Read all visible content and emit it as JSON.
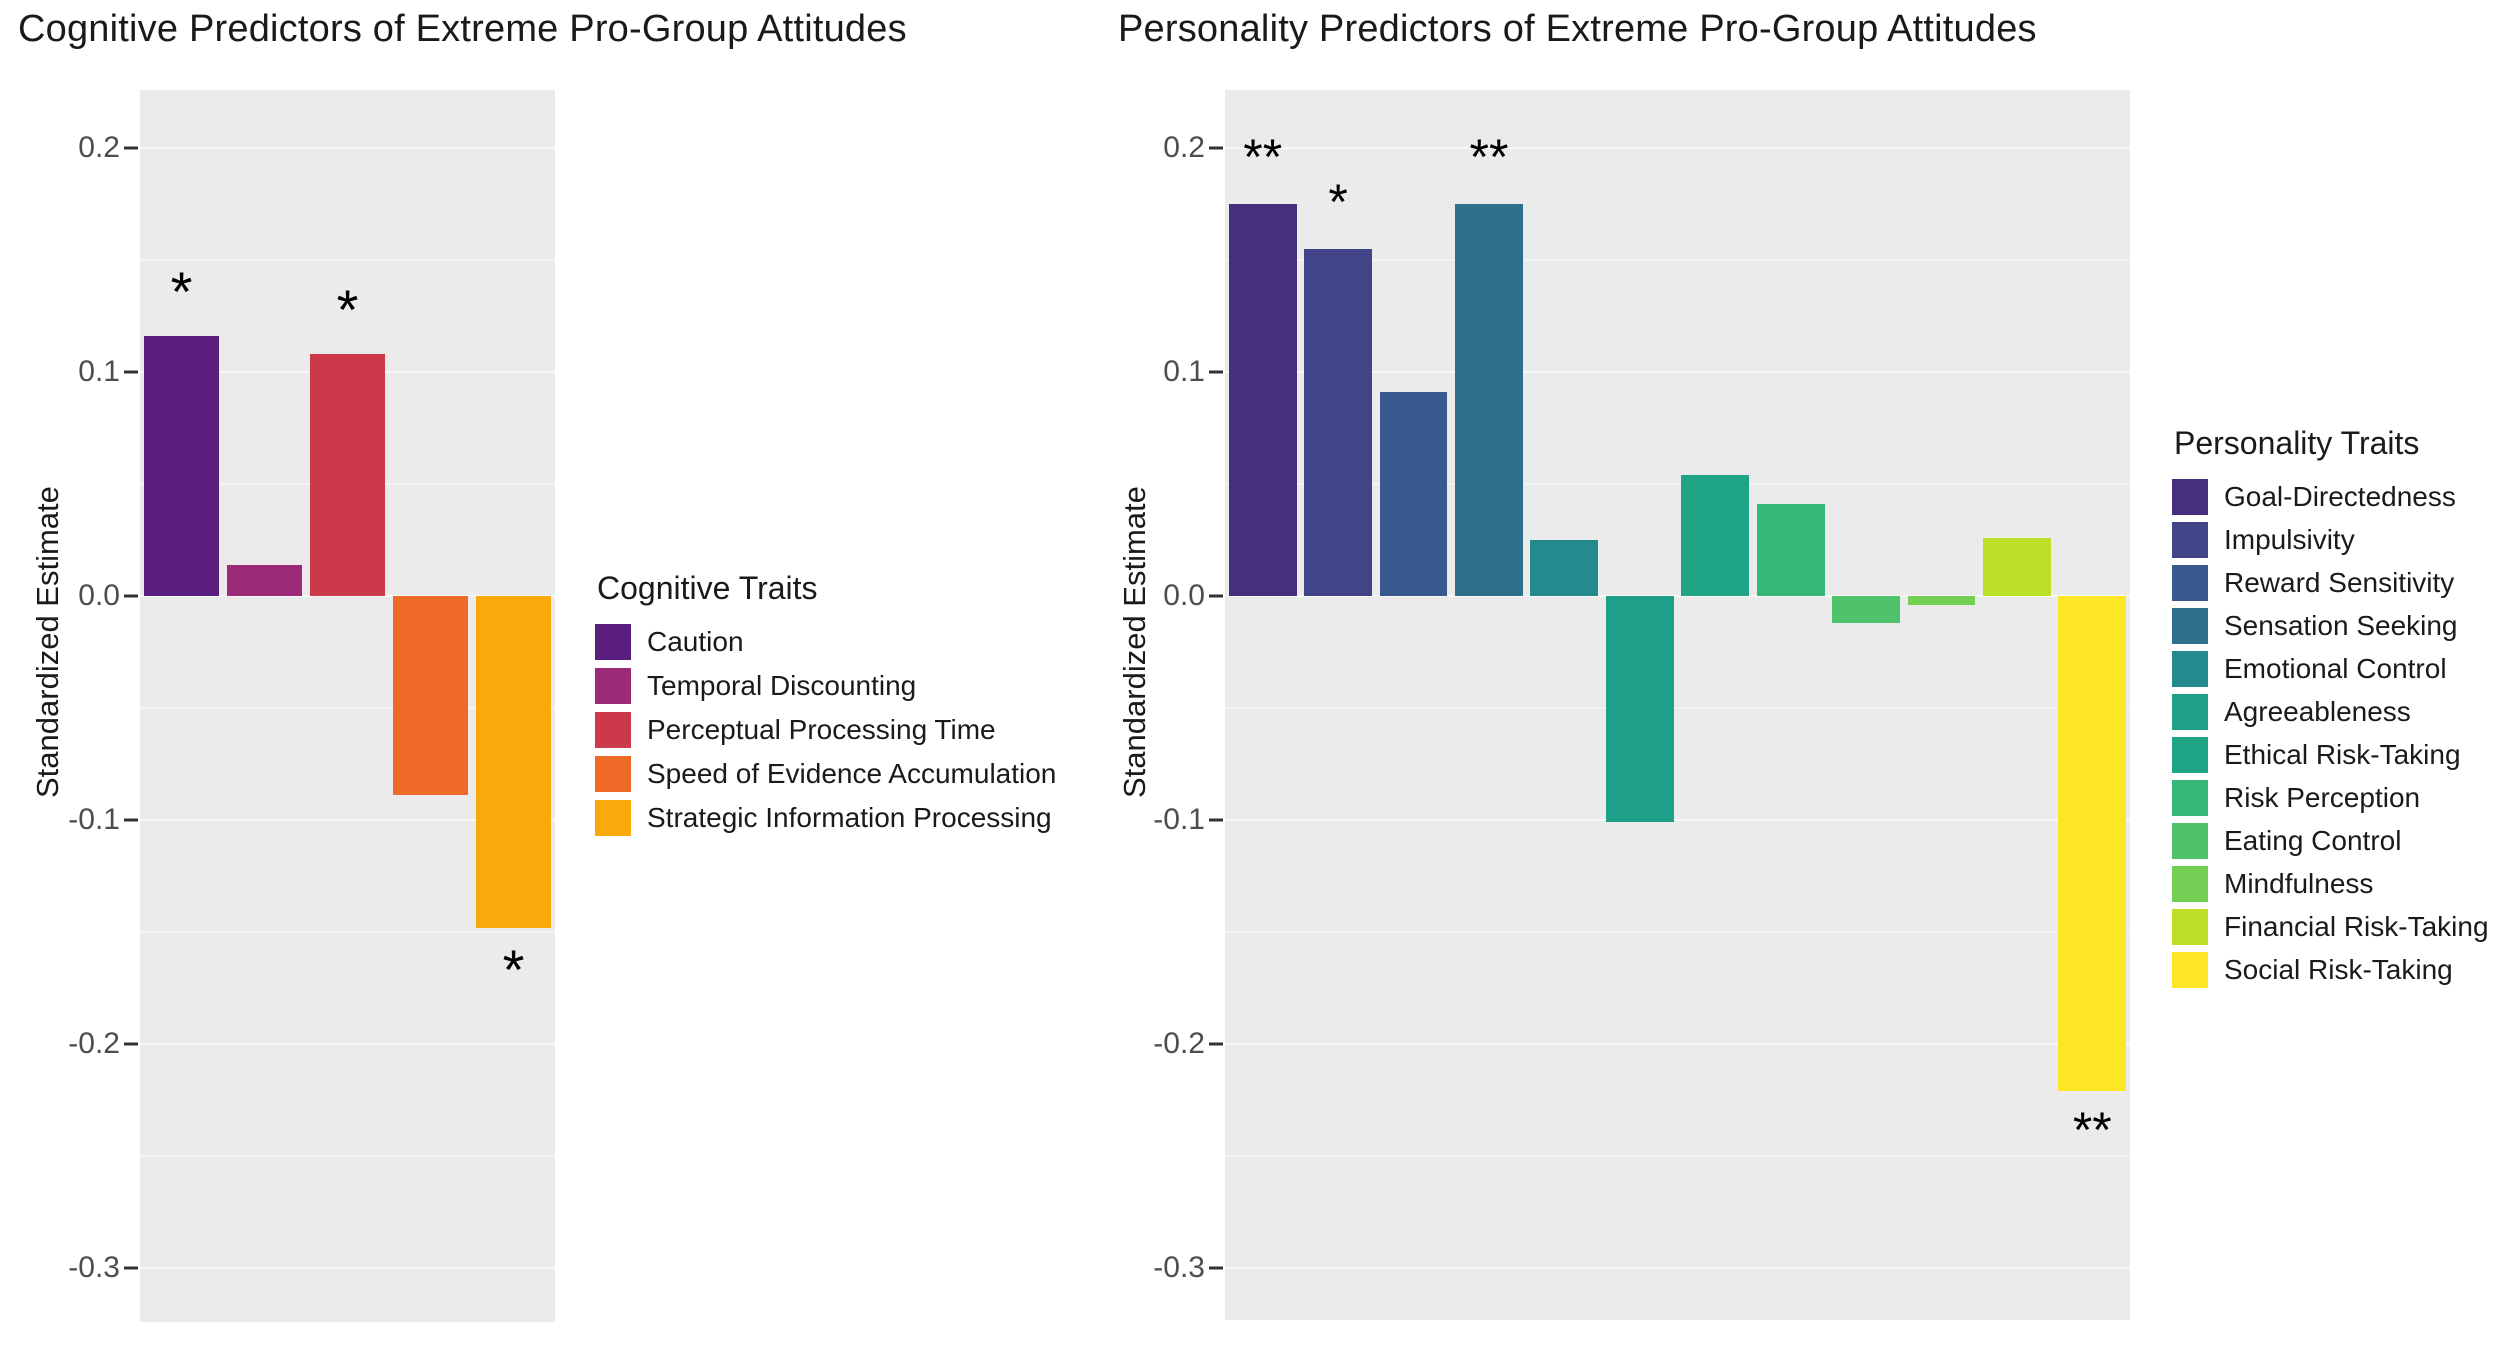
{
  "panels": {
    "left": {
      "title": "Cognitive Predictors of Extreme Pro-Group Attitudes",
      "axis_title": "Standardized Estimate",
      "legend_title": "Cognitive Traits"
    },
    "right": {
      "title": "Personality Predictors of Extreme Pro-Group Attitudes",
      "axis_title": "Standardized Estimate",
      "legend_title": "Personality Traits"
    }
  },
  "chart_data": [
    {
      "type": "bar",
      "title": "Cognitive Predictors of Extreme Pro-Group Attitudes",
      "xlabel": "",
      "ylabel": "Standardized Estimate",
      "ylim": [
        -0.33,
        0.235
      ],
      "yticks": [
        "0.2",
        "0.1",
        "0.0",
        "-0.1",
        "-0.2",
        "-0.3"
      ],
      "ytick_values": [
        0.2,
        0.1,
        0.0,
        -0.1,
        -0.2,
        -0.3
      ],
      "grid": true,
      "legend_position": "right",
      "legend_title": "Cognitive Traits",
      "categories": [
        "Caution",
        "Temporal Discounting",
        "Perceptual Processing Time",
        "Speed of Evidence Accumulation",
        "Strategic Information Processing"
      ],
      "values": [
        0.116,
        0.014,
        0.108,
        -0.089,
        -0.148
      ],
      "significance": [
        "*",
        "",
        "*",
        "",
        "*"
      ],
      "colors": [
        "#5A1F7E",
        "#9B2A78",
        "#CC394B",
        "#EE6A26",
        "#F9A90A"
      ]
    },
    {
      "type": "bar",
      "title": "Personality Predictors of Extreme Pro-Group Attitudes",
      "xlabel": "",
      "ylabel": "Standardized Estimate",
      "ylim": [
        -0.33,
        0.235
      ],
      "yticks": [
        "0.2",
        "0.1",
        "0.0",
        "-0.1",
        "-0.2",
        "-0.3"
      ],
      "ytick_values": [
        0.2,
        0.1,
        0.0,
        -0.1,
        -0.2,
        -0.3
      ],
      "grid": true,
      "legend_position": "right",
      "legend_title": "Personality Traits",
      "categories": [
        "Goal-Directedness",
        "Impulsivity",
        "Reward Sensitivity",
        "Sensation Seeking",
        "Emotional Control",
        "Agreeableness",
        "Ethical Risk-Taking",
        "Risk Perception",
        "Eating Control",
        "Mindfulness",
        "Financial Risk-Taking",
        "Social Risk-Taking"
      ],
      "values": [
        0.175,
        0.155,
        0.091,
        0.175,
        0.025,
        -0.101,
        0.054,
        0.041,
        -0.012,
        -0.004,
        0.026,
        -0.221
      ],
      "significance": [
        "**",
        "*",
        "",
        "**",
        "",
        "",
        "",
        "",
        "",
        "",
        "",
        "**"
      ],
      "colors": [
        "#46307E",
        "#414487",
        "#37598E",
        "#2D708E",
        "#238A8D",
        "#1F9E89",
        "#20A486",
        "#35B779",
        "#4EC36B",
        "#73D055",
        "#BCDF27",
        "#FDE725"
      ]
    }
  ],
  "legend_left": {
    "title": "Cognitive Traits",
    "items": [
      {
        "label": "Caution",
        "color": "#5A1F7E"
      },
      {
        "label": "Temporal Discounting",
        "color": "#9B2A78"
      },
      {
        "label": "Perceptual Processing Time",
        "color": "#CC394B"
      },
      {
        "label": "Speed of Evidence Accumulation",
        "color": "#EE6A26"
      },
      {
        "label": "Strategic Information Processing",
        "color": "#F9A90A"
      }
    ]
  },
  "legend_right": {
    "title": "Personality Traits",
    "items": [
      {
        "label": "Goal-Directedness",
        "color": "#46307E"
      },
      {
        "label": "Impulsivity",
        "color": "#414487"
      },
      {
        "label": "Reward Sensitivity",
        "color": "#37598E"
      },
      {
        "label": "Sensation Seeking",
        "color": "#2D708E"
      },
      {
        "label": "Emotional Control",
        "color": "#238A8D"
      },
      {
        "label": "Agreeableness",
        "color": "#1F9E89"
      },
      {
        "label": "Ethical Risk-Taking",
        "color": "#20A486"
      },
      {
        "label": "Risk Perception",
        "color": "#35B779"
      },
      {
        "label": "Eating Control",
        "color": "#4EC36B"
      },
      {
        "label": "Mindfulness",
        "color": "#73D055"
      },
      {
        "label": "Financial Risk-Taking",
        "color": "#BCDF27"
      },
      {
        "label": "Social Risk-Taking",
        "color": "#FDE725"
      }
    ]
  },
  "axis": {
    "tick_labels": [
      "0.2",
      "0.1",
      "0.0",
      "-0.1",
      "-0.2",
      "-0.3"
    ]
  }
}
